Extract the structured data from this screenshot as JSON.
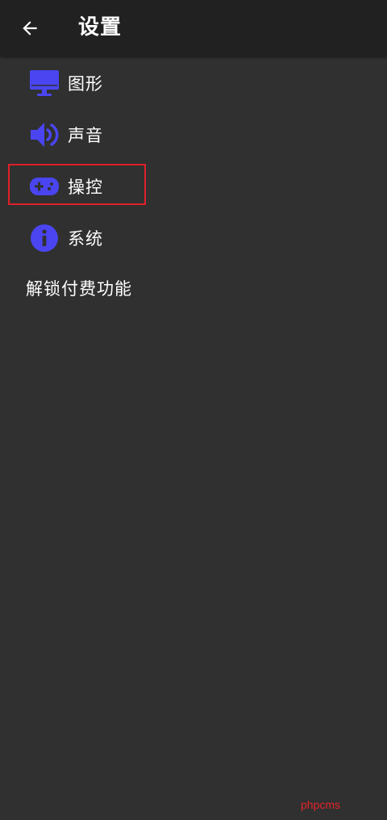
{
  "header": {
    "title": "设置",
    "back_icon": "arrow-left-icon"
  },
  "menu": {
    "items": [
      {
        "label": "图形",
        "icon": "monitor-icon"
      },
      {
        "label": "声音",
        "icon": "speaker-icon"
      },
      {
        "label": "操控",
        "icon": "gamepad-icon",
        "highlighted": true
      },
      {
        "label": "系统",
        "icon": "info-icon"
      }
    ],
    "unlock_label": "解锁付费功能"
  },
  "watermark": "phpcms",
  "colors": {
    "background": "#303030",
    "topbar": "#212121",
    "icon_accent": "#4a45f0",
    "text": "#ffffff",
    "highlight_border": "#e0202a",
    "watermark": "#e3252a"
  }
}
